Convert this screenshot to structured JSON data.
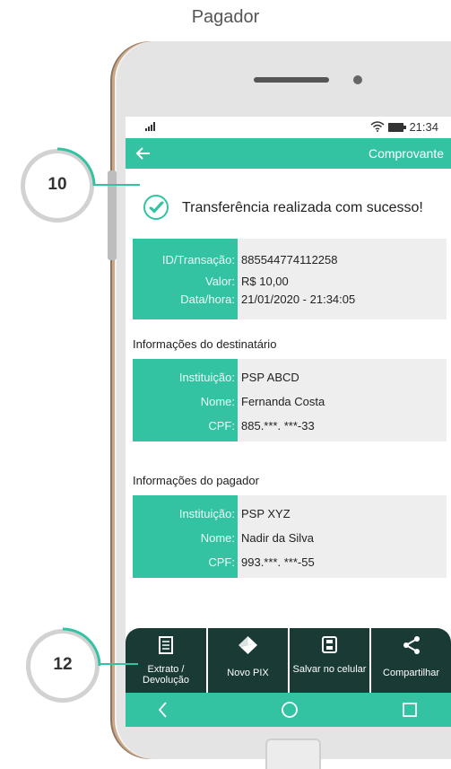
{
  "caption": "Pagador",
  "status": {
    "time": "21:34"
  },
  "appbar": {
    "title": "Comprovante",
    "back_icon": "arrow-left-icon"
  },
  "success_message": "Transferência realizada com sucesso!",
  "transaction": [
    {
      "key": "ID/Transação:",
      "value": "885544774112258"
    },
    {
      "key": "Valor:",
      "value": "R$ 10,00"
    },
    {
      "key": "Data/hora:",
      "value": "21/01/2020 - 21:34:05"
    }
  ],
  "recipient": {
    "heading": "Informações do destinatário",
    "rows": [
      {
        "key": "Instituição:",
        "value": "PSP ABCD"
      },
      {
        "key": "Nome:",
        "value": "Fernanda Costa"
      },
      {
        "key": "CPF:",
        "value": "885.***. ***-33"
      }
    ]
  },
  "payer": {
    "heading": "Informações do pagador",
    "rows": [
      {
        "key": "Instituição:",
        "value": "PSP XYZ"
      },
      {
        "key": "Nome:",
        "value": "Nadir da Silva"
      },
      {
        "key": "CPF:",
        "value": "993.***. ***-55"
      }
    ]
  },
  "toolbar": {
    "extrato": "Extrato / Devolução",
    "novo_pix": "Novo PIX",
    "salvar": "Salvar no celular",
    "compartilhar": "Compartilhar"
  },
  "callouts": {
    "c10": "10",
    "c12": "12"
  },
  "colors": {
    "accent": "#33c3a3",
    "toolbar": "#1a3a36"
  }
}
